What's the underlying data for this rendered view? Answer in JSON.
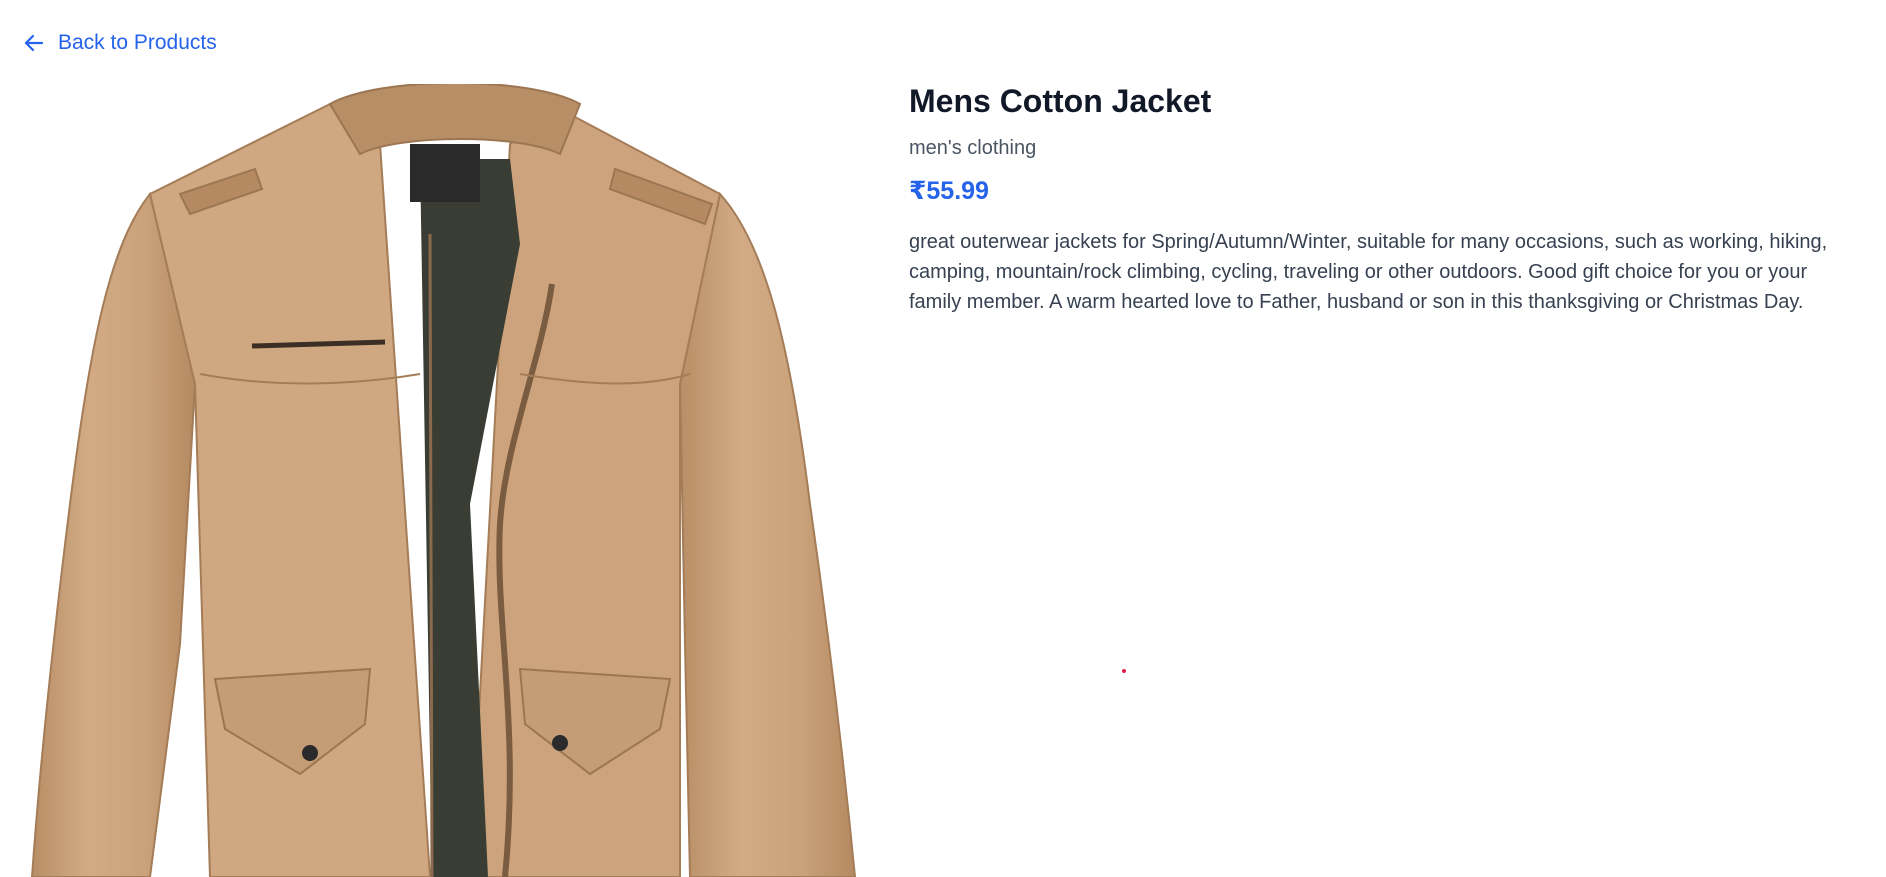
{
  "navigation": {
    "back_label": "Back to Products",
    "back_icon": "arrow-left-icon"
  },
  "product": {
    "title": "Mens Cotton Jacket",
    "category": "men's clothing",
    "price": "₹55.99",
    "description": "great outerwear jackets for Spring/Autumn/Winter, suitable for many occasions, such as working, hiking, camping, mountain/rock climbing, cycling, traveling or other outdoors. Good gift choice for you or your family member. A warm hearted love to Father, husband or son in this thanksgiving or Christmas Day.",
    "image_icon": "jacket-product-image"
  },
  "colors": {
    "accent": "#2563eb",
    "title": "#111827",
    "muted": "#4b5563",
    "body": "#374151",
    "jacket": "#c9a27c",
    "lining": "#3a3d33"
  }
}
